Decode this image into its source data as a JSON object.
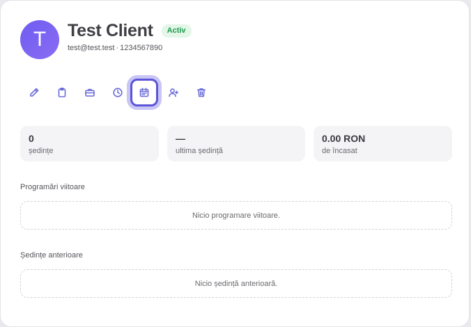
{
  "client": {
    "avatar_letter": "T",
    "name": "Test Client",
    "status": "Activ",
    "email": "test@test.test",
    "separator": "·",
    "phone": "1234567890"
  },
  "toolbar": {
    "icons": [
      "pencil-icon",
      "clipboard-icon",
      "briefcase-icon",
      "clock-icon",
      "calendar-icon",
      "user-plus-icon",
      "trash-icon"
    ],
    "active": "calendar-icon"
  },
  "stats": [
    {
      "value": "0",
      "label": "ședințe"
    },
    {
      "value": "—",
      "label": "ultima ședință"
    },
    {
      "value": "0.00 RON",
      "label": "de încasat"
    }
  ],
  "upcoming": {
    "title": "Programări viitoare",
    "empty": "Nicio programare viitoare."
  },
  "past": {
    "title": "Ședințe anterioare",
    "empty": "Nicio ședință anterioară."
  },
  "colors": {
    "accent": "#5b55d6",
    "avatar": "#7462f2",
    "badge_text": "#1f9a4d",
    "badge_bg": "#e3f6e8"
  }
}
